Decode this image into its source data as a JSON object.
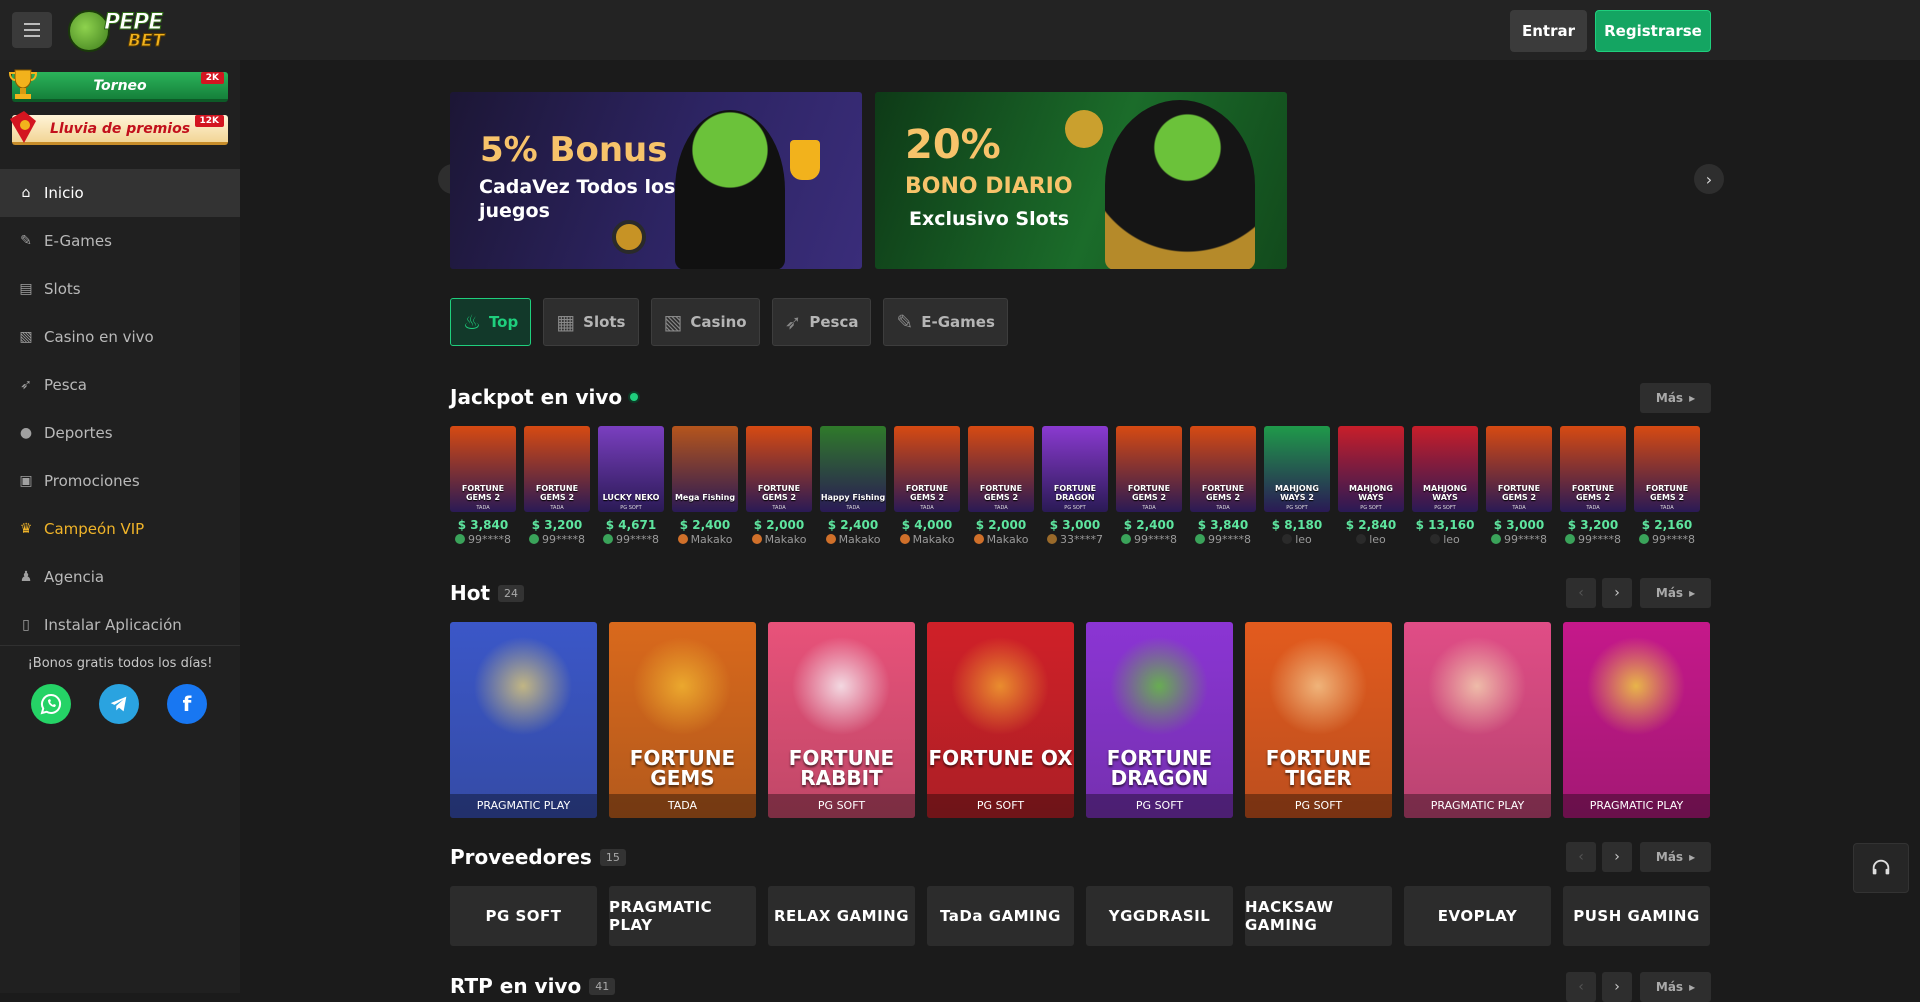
{
  "header": {
    "logo_top": "PEPE",
    "logo_bottom": "BET",
    "login_label": "Entrar",
    "register_label": "Registrarse"
  },
  "sidebar": {
    "promos": [
      {
        "label": "Torneo",
        "badge": "2K"
      },
      {
        "label": "Lluvia de premios",
        "badge": "12K"
      }
    ],
    "items": [
      {
        "label": "Inicio",
        "icon": "home-icon"
      },
      {
        "label": "E-Games",
        "icon": "egames-icon"
      },
      {
        "label": "Slots",
        "icon": "slots-icon"
      },
      {
        "label": "Casino en vivo",
        "icon": "cards-icon"
      },
      {
        "label": "Pesca",
        "icon": "fish-icon"
      },
      {
        "label": "Deportes",
        "icon": "soccer-ball-icon"
      },
      {
        "label": "Promociones",
        "icon": "gift-icon"
      },
      {
        "label": "Campeón VIP",
        "icon": "crown-icon"
      },
      {
        "label": "Agencia",
        "icon": "users-icon"
      },
      {
        "label": "Instalar Aplicación",
        "icon": "install-app-icon"
      }
    ],
    "bonus_text": "¡Bonos gratis todos los días!",
    "socials": [
      {
        "name": "whatsapp",
        "color": "#25d366"
      },
      {
        "name": "telegram",
        "color": "#2aa3e0"
      },
      {
        "name": "facebook",
        "color": "#1877f2"
      }
    ]
  },
  "banners": [
    {
      "big": "5% Bonus",
      "sub1": "CadaVez Todos los",
      "sub2": "juegos"
    },
    {
      "big1": "20%",
      "big2": "BONO DIARIO",
      "sub": "Exclusivo Slots"
    }
  ],
  "categories": [
    {
      "label": "Top",
      "active": true
    },
    {
      "label": "Slots"
    },
    {
      "label": "Casino"
    },
    {
      "label": "Pesca"
    },
    {
      "label": "E-Games"
    }
  ],
  "jackpot": {
    "title": "Jackpot en vivo",
    "more_label": "Más",
    "items": [
      {
        "game": "FORTUNE GEMS 2",
        "brand": "TADA",
        "amount": "$ 3,840",
        "user": "99****8",
        "color": "#d64a12"
      },
      {
        "game": "FORTUNE GEMS 2",
        "brand": "TADA",
        "amount": "$ 3,200",
        "user": "99****8",
        "color": "#d64a12"
      },
      {
        "game": "LUCKY NEKO",
        "brand": "PG SOFT",
        "amount": "$ 4,671",
        "user": "99****8",
        "color": "#7a3fc0"
      },
      {
        "game": "Mega Fishing",
        "brand": "",
        "amount": "$ 2,400",
        "user": "Makako",
        "color": "#b5551c"
      },
      {
        "game": "FORTUNE GEMS 2",
        "brand": "TADA",
        "amount": "$ 2,000",
        "user": "Makako",
        "color": "#d64a12"
      },
      {
        "game": "Happy Fishing",
        "brand": "TADA",
        "amount": "$ 2,400",
        "user": "Makako",
        "color": "#2f7a2a"
      },
      {
        "game": "FORTUNE GEMS 2",
        "brand": "TADA",
        "amount": "$ 4,000",
        "user": "Makako",
        "color": "#d64a12"
      },
      {
        "game": "FORTUNE GEMS 2",
        "brand": "TADA",
        "amount": "$ 2,000",
        "user": "Makako",
        "color": "#d64a12"
      },
      {
        "game": "FORTUNE DRAGON",
        "brand": "PG SOFT",
        "amount": "$ 3,000",
        "user": "33****7",
        "color": "#8a3ad0"
      },
      {
        "game": "FORTUNE GEMS 2",
        "brand": "TADA",
        "amount": "$ 2,400",
        "user": "99****8",
        "color": "#d64a12"
      },
      {
        "game": "FORTUNE GEMS 2",
        "brand": "TADA",
        "amount": "$ 3,840",
        "user": "99****8",
        "color": "#d64a12"
      },
      {
        "game": "MAHJONG WAYS 2",
        "brand": "PG SOFT",
        "amount": "$ 8,180",
        "user": "leo",
        "color": "#1f9a4a"
      },
      {
        "game": "MAHJONG WAYS",
        "brand": "PG SOFT",
        "amount": "$ 2,840",
        "user": "leo",
        "color": "#c81e2a"
      },
      {
        "game": "MAHJONG WAYS",
        "brand": "PG SOFT",
        "amount": "$ 13,160",
        "user": "leo",
        "color": "#c81e2a"
      },
      {
        "game": "FORTUNE GEMS 2",
        "brand": "TADA",
        "amount": "$ 3,000",
        "user": "99****8",
        "color": "#d64a12"
      },
      {
        "game": "FORTUNE GEMS 2",
        "brand": "TADA",
        "amount": "$ 3,200",
        "user": "99****8",
        "color": "#d64a12"
      },
      {
        "game": "FORTUNE GEMS 2",
        "brand": "TADA",
        "amount": "$ 2,160",
        "user": "99****8",
        "color": "#d64a12"
      }
    ]
  },
  "hot": {
    "title": "Hot",
    "count": "24",
    "more_label": "Más",
    "games": [
      {
        "name": "",
        "provider": "PRAGMATIC PLAY",
        "bg": "#3b57c8",
        "art": "#d9c77a"
      },
      {
        "name": "FORTUNE GEMS",
        "provider": "TADA",
        "bg": "#d9691c",
        "art": "#f0b431"
      },
      {
        "name": "FORTUNE RABBIT",
        "provider": "PG SOFT",
        "bg": "#e8527a",
        "art": "#f7f0f4"
      },
      {
        "name": "FORTUNE OX",
        "provider": "PG SOFT",
        "bg": "#d02028",
        "art": "#f0a030"
      },
      {
        "name": "FORTUNE DRAGON",
        "provider": "PG SOFT",
        "bg": "#8b35d4",
        "art": "#63c23e"
      },
      {
        "name": "FORTUNE TIGER",
        "provider": "PG SOFT",
        "bg": "#e35b1e",
        "art": "#f4c48a"
      },
      {
        "name": "",
        "provider": "PRAGMATIC PLAY",
        "bg": "#e04d86",
        "art": "#f3cfb0"
      },
      {
        "name": "",
        "provider": "PRAGMATIC PLAY",
        "bg": "#c5188a",
        "art": "#f0d040"
      }
    ]
  },
  "providers": {
    "title": "Proveedores",
    "count": "15",
    "more_label": "Más",
    "items": [
      "PG SOFT",
      "PRAGMATIC PLAY",
      "RELAX GAMING",
      "TaDa GAMING",
      "YGGDRASIL",
      "HACKSAW GAMING",
      "EVOPLAY",
      "PUSH GAMING"
    ]
  },
  "rtp": {
    "title": "RTP en vivo",
    "count": "41",
    "more_label": "Más"
  }
}
